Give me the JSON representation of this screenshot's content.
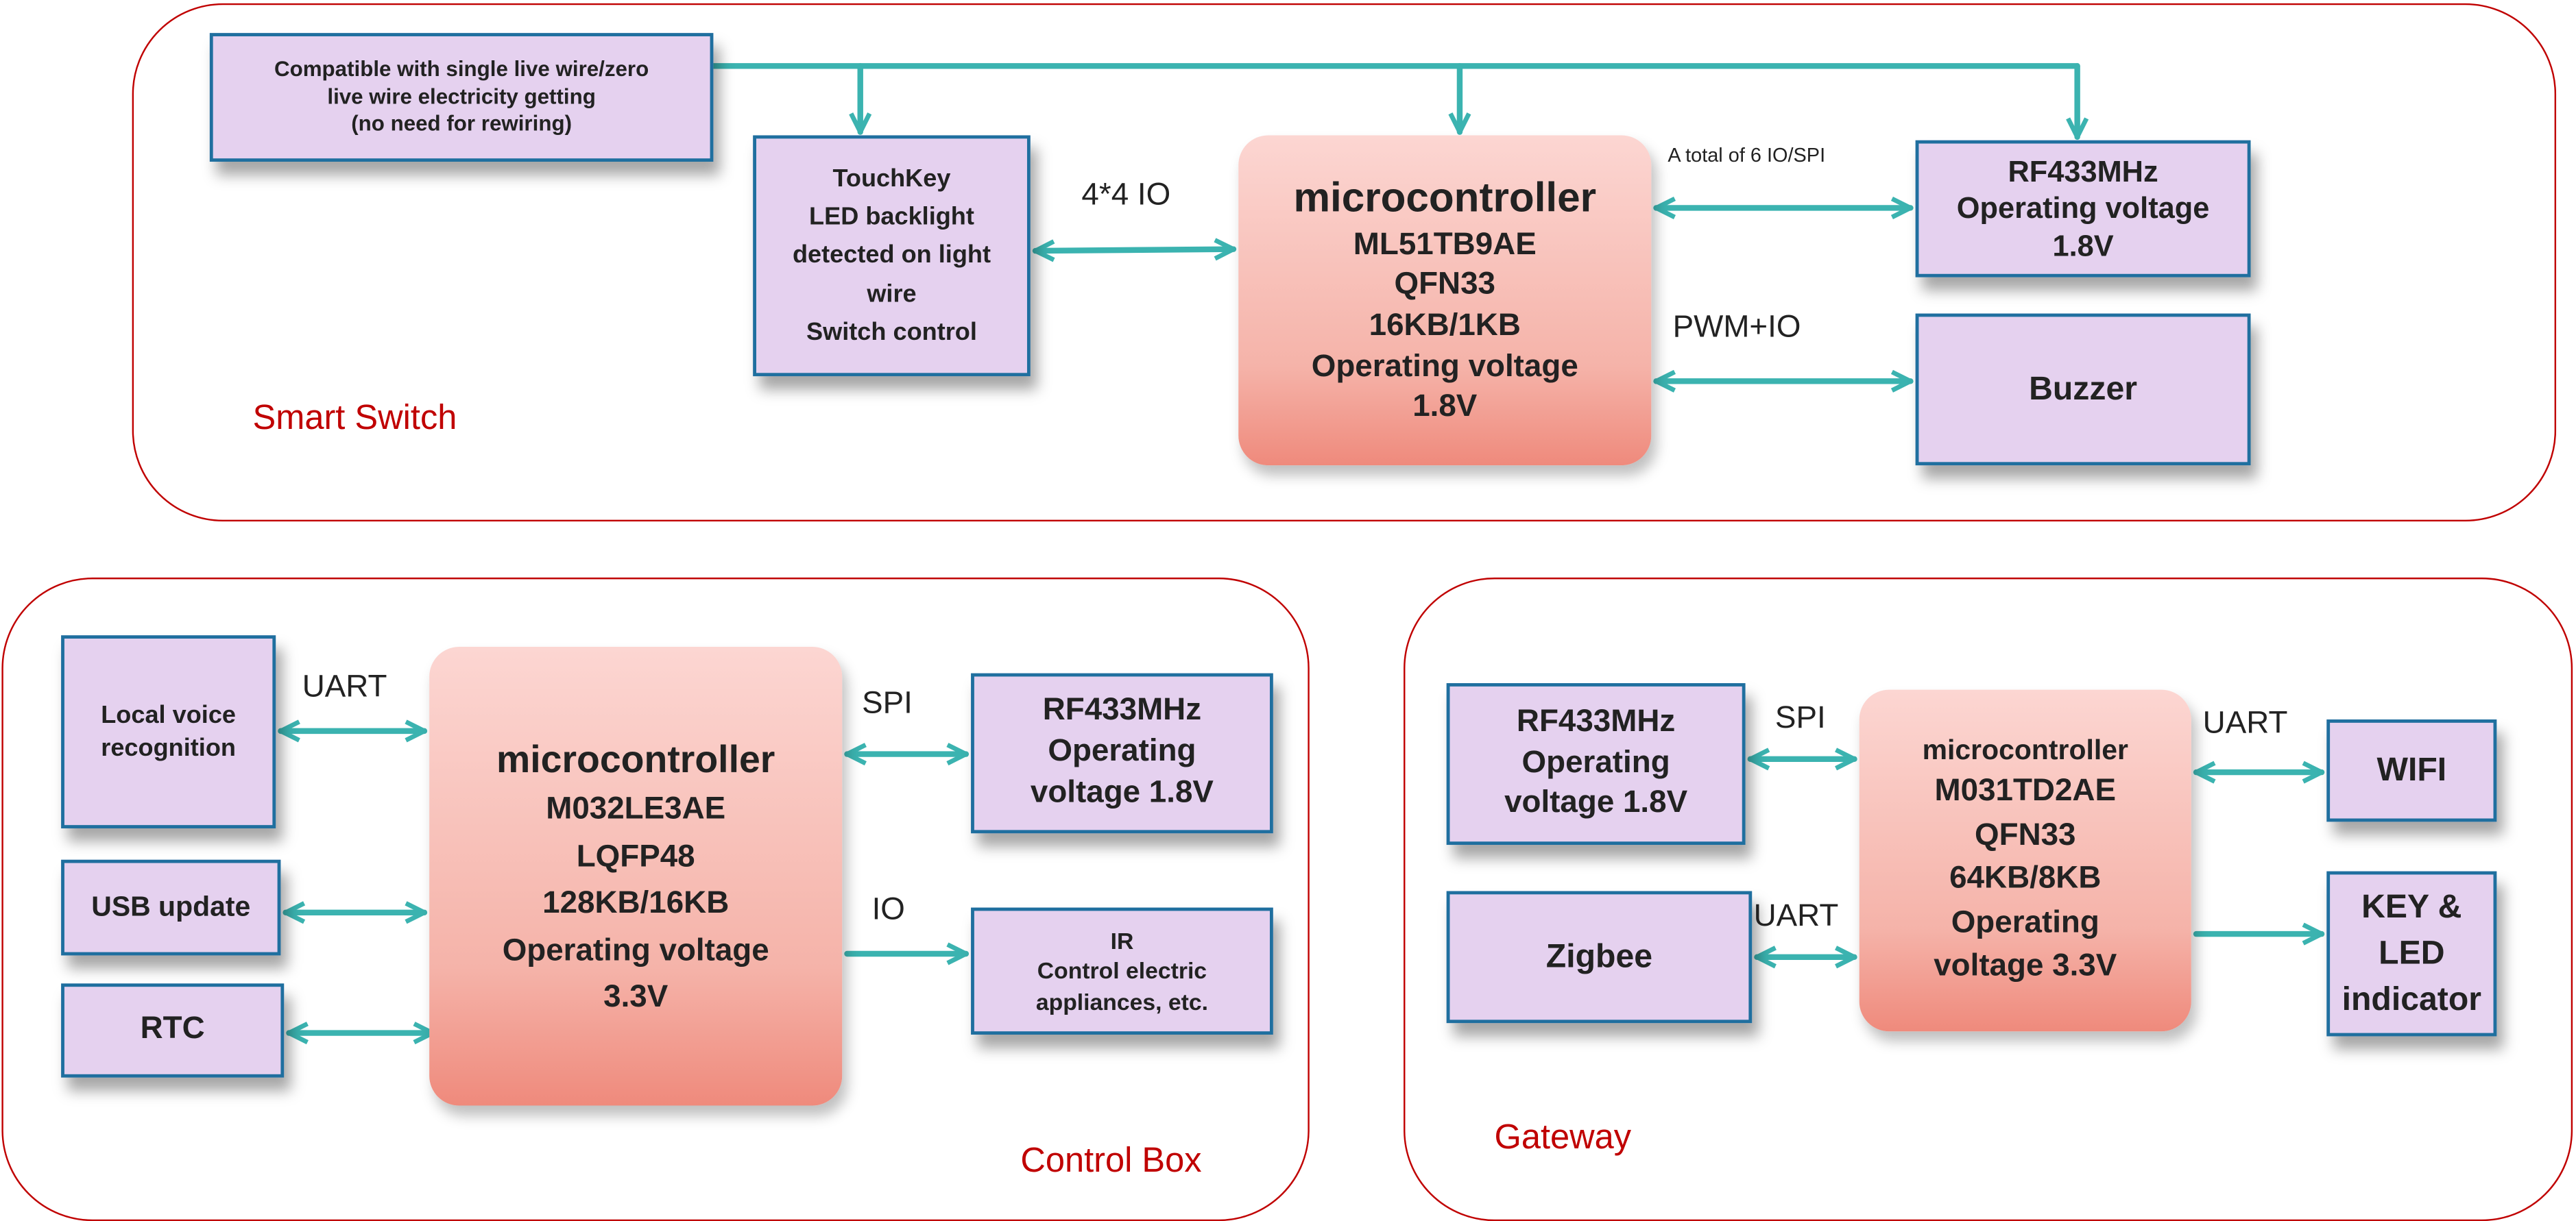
{
  "colors": {
    "panel_border": "#c00000",
    "box_fill": "#e5d1ef",
    "box_border": "#1f6f9f",
    "connector": "#3bb3b0",
    "mcu_top": "#fcd6d2",
    "mcu_bottom": "#ef8a7c"
  },
  "smart_switch": {
    "title": "Smart Switch",
    "power_box": [
      "Compatible with single live wire/zero",
      "live wire electricity getting",
      "(no need for rewiring)"
    ],
    "touch_box": [
      "TouchKey",
      "LED backlight",
      "detected on light",
      "wire",
      "Switch control"
    ],
    "mcu": [
      "microcontroller",
      "ML51TB9AE",
      "QFN33",
      "16KB/1KB",
      "Operating voltage",
      "1.8V"
    ],
    "rf_box": [
      "RF433MHz",
      "Operating voltage",
      "1.8V"
    ],
    "buzzer_box": "Buzzer",
    "labels": {
      "touch_link": "4*4 IO",
      "rf_link": "A total of 6 IO/SPI",
      "buzzer_link": "PWM+IO"
    }
  },
  "control_box": {
    "title": "Control Box",
    "voice_box": [
      "Local voice",
      "recognition"
    ],
    "usb_box": "USB update",
    "rtc_box": "RTC",
    "mcu": [
      "microcontroller",
      "M032LE3AE",
      "LQFP48",
      "128KB/16KB",
      "Operating voltage",
      "3.3V"
    ],
    "rf_box": [
      "RF433MHz",
      "Operating",
      "voltage 1.8V"
    ],
    "ir_box": [
      "IR",
      "Control electric",
      "appliances, etc."
    ],
    "labels": {
      "voice_link": "UART",
      "rf_link": "SPI",
      "ir_link": "IO"
    }
  },
  "gateway": {
    "title": "Gateway",
    "rf_box": [
      "RF433MHz",
      "Operating",
      "voltage 1.8V"
    ],
    "zigbee_box": "Zigbee",
    "mcu": [
      "microcontroller",
      "M031TD2AE",
      "QFN33",
      "64KB/8KB",
      "Operating",
      "voltage 3.3V"
    ],
    "wifi_box": "WIFI",
    "key_box": [
      "KEY &",
      "LED",
      "indicator"
    ],
    "labels": {
      "rf_link": "SPI",
      "zigbee_link": "UART",
      "wifi_link": "UART"
    }
  }
}
